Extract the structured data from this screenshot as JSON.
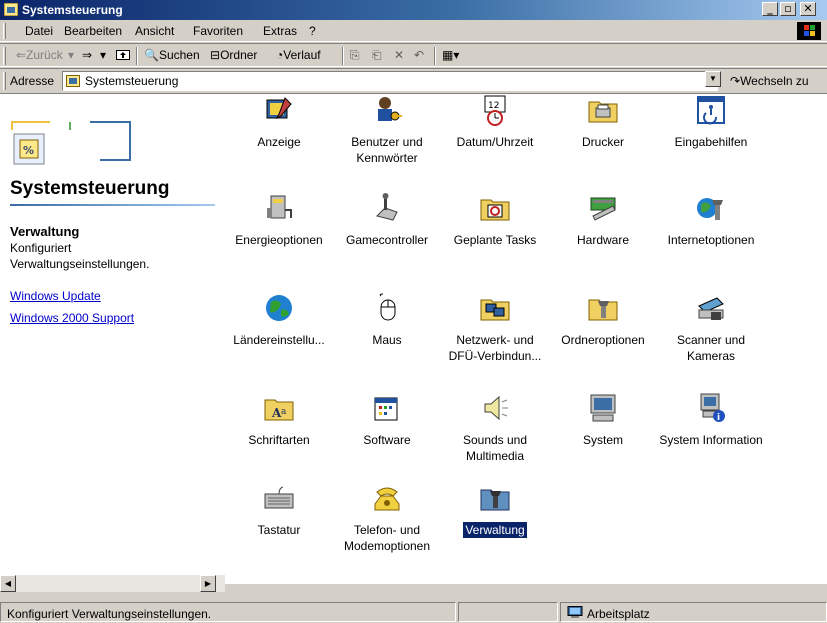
{
  "window": {
    "title": "Systemsteuerung",
    "buttons": [
      "_",
      "▫",
      "✕"
    ]
  },
  "menu": [
    "Datei",
    "Bearbeiten",
    "Ansicht",
    "Favoriten",
    "Extras",
    "?"
  ],
  "toolbar": {
    "back": "⇐Zurück",
    "forward": "⇒",
    "search": "Suchen",
    "folders": "Ordner",
    "history": "Verlauf"
  },
  "address": {
    "label": "Adresse",
    "value": "Systemsteuerung",
    "go": "Wechseln zu"
  },
  "left": {
    "title": "Systemsteuerung",
    "selected_title": "Verwaltung",
    "selected_desc_1": "Konfiguriert",
    "selected_desc_2": "Verwaltungseinstellungen.",
    "links": [
      "Windows Update",
      "Windows 2000 Support"
    ]
  },
  "items": [
    {
      "label": "Anzeige",
      "icon": "display-icon"
    },
    {
      "label": "Benutzer und Kennwörter",
      "icon": "users-passwords-icon"
    },
    {
      "label": "Datum/Uhrzeit",
      "icon": "date-time-icon"
    },
    {
      "label": "Drucker",
      "icon": "printer-folder-icon"
    },
    {
      "label": "Eingabehilfen",
      "icon": "accessibility-icon"
    },
    {
      "label": "Energieoptionen",
      "icon": "power-options-icon"
    },
    {
      "label": "Gamecontroller",
      "icon": "game-controller-icon"
    },
    {
      "label": "Geplante Tasks",
      "icon": "scheduled-tasks-icon"
    },
    {
      "label": "Hardware",
      "icon": "hardware-icon"
    },
    {
      "label": "Internetoptionen",
      "icon": "internet-options-icon"
    },
    {
      "label": "Ländereinstellu...",
      "icon": "globe-icon"
    },
    {
      "label": "Maus",
      "icon": "mouse-icon"
    },
    {
      "label": "Netzwerk- und DFÜ-Verbindun...",
      "icon": "network-icon"
    },
    {
      "label": "Ordneroptionen",
      "icon": "folder-options-icon"
    },
    {
      "label": "Scanner und Kameras",
      "icon": "scanner-camera-icon"
    },
    {
      "label": "Schriftarten",
      "icon": "fonts-icon"
    },
    {
      "label": "Software",
      "icon": "software-icon"
    },
    {
      "label": "Sounds und Multimedia",
      "icon": "speaker-icon"
    },
    {
      "label": "System",
      "icon": "computer-icon"
    },
    {
      "label": "System Information",
      "icon": "system-information-icon"
    },
    {
      "label": "Tastatur",
      "icon": "keyboard-icon"
    },
    {
      "label": "Telefon- und Modemoptionen",
      "icon": "telephone-icon"
    },
    {
      "label": "Verwaltung",
      "icon": "administrative-tools-icon",
      "selected": true
    }
  ],
  "status": {
    "text": "Konfiguriert Verwaltungseinstellungen.",
    "zone": "Arbeitsplatz"
  }
}
